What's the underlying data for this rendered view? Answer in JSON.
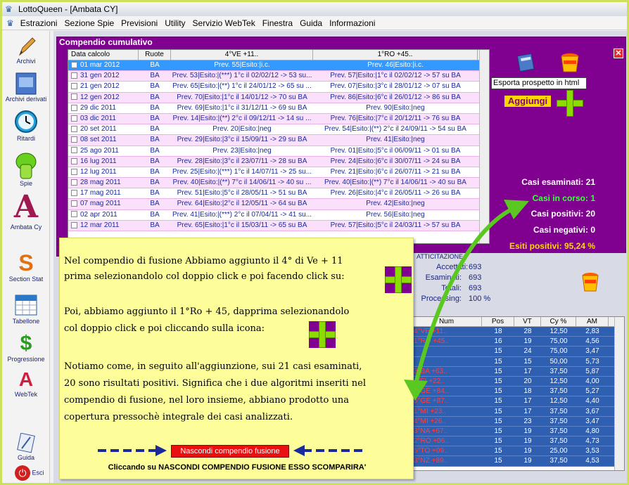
{
  "window": {
    "title": "LottoQueen - [Ambata CY]"
  },
  "menu": [
    "Estrazioni",
    "Sezione Spie",
    "Previsioni",
    "Utility",
    "Servizio WebTek",
    "Finestra",
    "Guida",
    "Informazioni"
  ],
  "sidebar": [
    {
      "label": "Archivi",
      "icon": "pencil-icon"
    },
    {
      "label": "Archivi derivati",
      "icon": "book-icon"
    },
    {
      "label": "Ritardi",
      "icon": "clock-icon"
    },
    {
      "label": "Spie",
      "icon": "flashlight-icon"
    },
    {
      "label": "Ambata Cy",
      "icon": "letter-a-icon"
    },
    {
      "label": "Section Stat",
      "icon": "letter-s-icon"
    },
    {
      "label": "Tabellone",
      "icon": "calendar-icon"
    },
    {
      "label": "Progressione",
      "icon": "dollar-icon"
    },
    {
      "label": "WebTek",
      "icon": "webtek-icon"
    },
    {
      "label": "Guida",
      "icon": "guide-icon"
    },
    {
      "label": "Esci",
      "icon": "power-icon"
    }
  ],
  "compendio": {
    "title": "Compendio cumulativo",
    "headers": [
      "Data calcolo",
      "Ruote",
      "4°VE +11..",
      "1°RO +45.."
    ],
    "rows": [
      [
        "01 mar 2012",
        "BA",
        "Prev. 55|Esito:|i.c.",
        "Prev. 46|Esito:|i.c."
      ],
      [
        "31 gen 2012",
        "BA",
        "Prev. 53|Esito:|(***) 1°c il 02/02/12 -> 53 su...",
        "Prev. 57|Esito:|1°c il 02/02/12 -> 57 su BA"
      ],
      [
        "21 gen 2012",
        "BA",
        "Prev. 65|Esito:|(**) 1°c il 24/01/12 -> 65 su ...",
        "Prev. 07|Esito:|3°c il 28/01/12 -> 07 su BA"
      ],
      [
        "12 gen 2012",
        "BA",
        "Prev. 70|Esito:|1°c il 14/01/12 -> 70 su BA",
        "Prev. 86|Esito:|6°c il 26/01/12 -> 86 su BA"
      ],
      [
        "29 dic 2011",
        "BA",
        "Prev. 69|Esito:|1°c il 31/12/11 -> 69 su BA",
        "Prev. 90|Esito:|neg"
      ],
      [
        "03 dic 2011",
        "BA",
        "Prev. 14|Esito:|(**) 2°c il 09/12/11 -> 14 su ...",
        "Prev. 76|Esito:|7°c il 20/12/11 -> 76 su BA"
      ],
      [
        "20 set 2011",
        "BA",
        "Prev. 20|Esito:|neg",
        "Prev. 54|Esito:|(**) 2°c il 24/09/11 -> 54 su BA"
      ],
      [
        "08 set 2011",
        "BA",
        "Prev. 29|Esito:|3°c il 15/09/11 -> 29 su BA",
        "Prev. 41|Esito:|neg"
      ],
      [
        "25 ago 2011",
        "BA",
        "Prev. 23|Esito:|neg",
        "Prev. 01|Esito:|5°c il 06/09/11 -> 01 su BA"
      ],
      [
        "16 lug 2011",
        "BA",
        "Prev. 28|Esito:|3°c il 23/07/11 -> 28 su BA",
        "Prev. 24|Esito:|6°c il 30/07/11 -> 24 su BA"
      ],
      [
        "12 lug 2011",
        "BA",
        "Prev. 25|Esito:|(***) 1°c il 14/07/11 -> 25 su...",
        "Prev. 21|Esito:|6°c il 26/07/11 -> 21 su BA"
      ],
      [
        "28 mag 2011",
        "BA",
        "Prev. 40|Esito:|(**) 7°c il 14/06/11 -> 40 su ...",
        "Prev. 40|Esito:|(**) 7°c il 14/06/11 -> 40 su BA"
      ],
      [
        "17 mag 2011",
        "BA",
        "Prev. 51|Esito:|5°c il 28/05/11 -> 51 su BA",
        "Prev. 26|Esito:|4°c il 26/05/11 -> 26 su BA"
      ],
      [
        "07 mag 2011",
        "BA",
        "Prev. 64|Esito:|2°c il 12/05/11 -> 64 su BA",
        "Prev. 42|Esito:|neg"
      ],
      [
        "02 apr 2011",
        "BA",
        "Prev. 41|Esito:|(***) 2°c il 07/04/11 -> 41 su...",
        "Prev. 56|Esito:|neg"
      ],
      [
        "12 mar 2011",
        "BA",
        "Prev. 65|Esito:|1°c il 15/03/11 -> 65 su BA",
        "Prev. 57|Esito:|5°c il 24/03/11 -> 57 su BA"
      ]
    ],
    "tooltip": "Esporta prospetto in html",
    "aggiungi": "Aggiungi",
    "stats": {
      "esaminati": "Casi esaminati: 21",
      "in_corso": "Casi in corso: 1",
      "positivi": "Casi positivi: 20",
      "negativi": "Casi negativi: 0",
      "esiti": "Esiti positivi: 95,24 %"
    }
  },
  "panel2": {
    "label0": "ATTICITAZIONE",
    "rows": [
      [
        "Accettati:",
        "693"
      ],
      [
        "Esaminati:",
        "693"
      ],
      [
        "Totali:",
        "693"
      ],
      [
        "Processing:",
        "100 %"
      ]
    ]
  },
  "table2": {
    "headers": [
      "Num",
      "Pos",
      "VT",
      "Cy %",
      "AM"
    ],
    "rows": [
      [
        "4°VE +11..",
        "18",
        "28",
        "12,50",
        "2,83"
      ],
      [
        "1°RO +45..",
        "16",
        "19",
        "75,00",
        "4,56"
      ],
      [
        "",
        "15",
        "24",
        "75,00",
        "3,47"
      ],
      [
        "",
        "15",
        "15",
        "50,00",
        "5,73"
      ],
      [
        "3°BA +63..",
        "15",
        "17",
        "37,50",
        "5,87"
      ],
      [
        "1°FI +22..",
        "15",
        "20",
        "12,50",
        "4,00"
      ],
      [
        "2°GE +84..",
        "15",
        "18",
        "37,50",
        "5,27"
      ],
      [
        "5°GE +87..",
        "15",
        "17",
        "12,50",
        "4,40"
      ],
      [
        "1°MI +23..",
        "15",
        "17",
        "37,50",
        "3,67"
      ],
      [
        "4°MI +26..",
        "15",
        "23",
        "37,50",
        "3,47"
      ],
      [
        "3°NA +67..",
        "15",
        "19",
        "37,50",
        "4,80"
      ],
      [
        "2°RO +06..",
        "15",
        "19",
        "37,50",
        "4,73"
      ],
      [
        "5°TO +09..",
        "15",
        "19",
        "25,00",
        "3,53"
      ],
      [
        "3°NZ +89..",
        "15",
        "19",
        "37,50",
        "4,53"
      ]
    ]
  },
  "note": {
    "p1a": "Nel compendio di fusione Abbiamo aggiunto il 4° di Ve + 11",
    "p1b": "prima selezionandolo col doppio click e poi facendo click su:",
    "p2a": "Poi, abbiamo aggiunto il 1°Ro + 45, dapprima selezionandolo",
    "p2b": "col doppio click e poi cliccando sulla icona:",
    "p3a": "Notiamo come, in seguito all'aggiunzione, sui 21 casi esaminati,",
    "p3b": "20 sono risultati positivi. Significa che i due algoritmi inseriti nel",
    "p3c": "compendio di fusione, nel loro insieme, abbiano prodotto una",
    "p3d": "copertura pressochè integrale dei casi analizzati.",
    "button": "Nascondi compendio fusione",
    "caption": "Cliccando su NASCONDI COMPENDIO FUSIONE ESSO SCOMPARIRA'"
  },
  "colors": {
    "accent": "#800090",
    "gold": "#ffd700",
    "green": "#8bdc00",
    "selected": "#3399ff"
  }
}
